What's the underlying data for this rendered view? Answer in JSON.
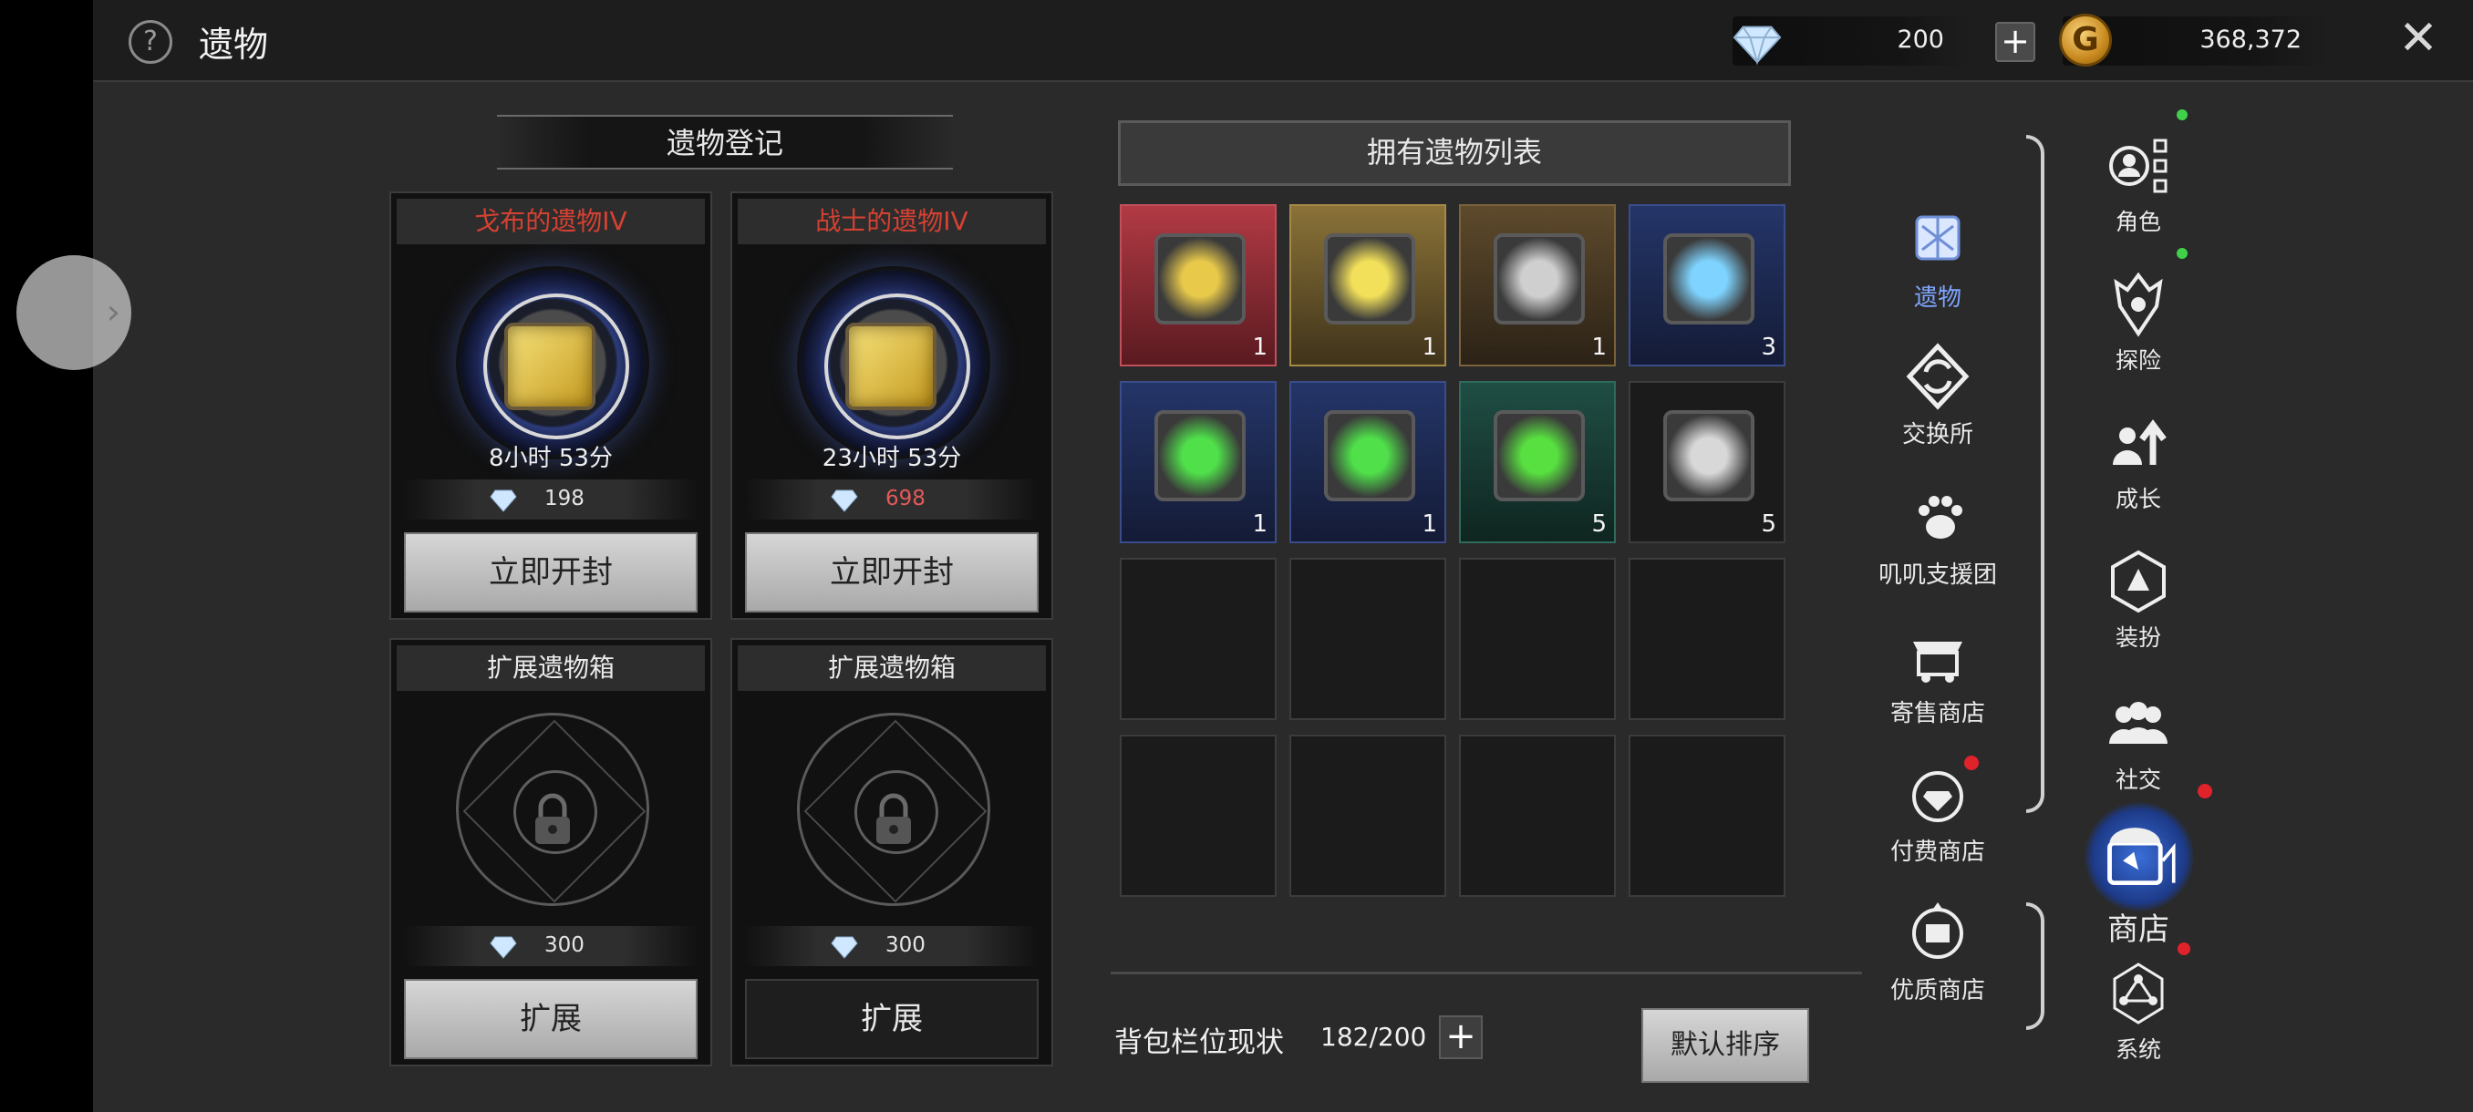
{
  "header": {
    "title": "遗物",
    "diamonds": "200",
    "gold": "368,372",
    "gold_symbol": "G"
  },
  "registration": {
    "title": "遗物登记",
    "slots": [
      {
        "name": "戈布的遗物IV",
        "timer": "8小时 53分",
        "cost": "198",
        "cost_red": false,
        "button": "立即开封"
      },
      {
        "name": "战士的遗物IV",
        "timer": "23小时 53分",
        "cost": "698",
        "cost_red": true,
        "button": "立即开封"
      },
      {
        "name": "扩展遗物箱",
        "cost": "300",
        "button": "扩展"
      },
      {
        "name": "扩展遗物箱",
        "cost": "300",
        "button": "扩展"
      }
    ]
  },
  "owned": {
    "title": "拥有遗物列表",
    "items": [
      {
        "rarity": "red",
        "color": "#e8c94a",
        "count": "1"
      },
      {
        "rarity": "gold",
        "color": "#f2e05a",
        "count": "1"
      },
      {
        "rarity": "brown",
        "color": "#cfcfcf",
        "count": "1"
      },
      {
        "rarity": "blue",
        "color": "#7fd4ff",
        "count": "3"
      },
      {
        "rarity": "blue",
        "color": "#4fe04a",
        "count": "1"
      },
      {
        "rarity": "blue",
        "color": "#4fe04a",
        "count": "1"
      },
      {
        "rarity": "teal",
        "color": "#58e040",
        "count": "5"
      },
      {
        "rarity": "none",
        "color": "#d8d8d8",
        "count": "5"
      }
    ],
    "bag_label": "背包栏位现状",
    "bag_value": "182/200",
    "sort_button": "默认排序"
  },
  "submenu": [
    {
      "label": "遗物",
      "icon": "relic-icon",
      "active": true
    },
    {
      "label": "交换所",
      "icon": "exchange-icon"
    },
    {
      "label": "叽叽支援团",
      "icon": "paw-icon"
    },
    {
      "label": "寄售商店",
      "icon": "consign-shop-icon"
    },
    {
      "label": "付费商店",
      "icon": "paid-shop-icon"
    },
    {
      "label": "优质商店",
      "icon": "premium-shop-icon"
    }
  ],
  "mainmenu": [
    {
      "label": "角色",
      "icon": "character-icon"
    },
    {
      "label": "探险",
      "icon": "adventure-icon"
    },
    {
      "label": "成长",
      "icon": "growth-icon"
    },
    {
      "label": "装扮",
      "icon": "costume-icon"
    },
    {
      "label": "社交",
      "icon": "social-icon"
    },
    {
      "label": "商店",
      "icon": "shop-icon"
    },
    {
      "label": "系统",
      "icon": "system-icon"
    }
  ],
  "colors": {
    "accent_blue": "#7ea6ff",
    "warning_red": "#d54132"
  }
}
